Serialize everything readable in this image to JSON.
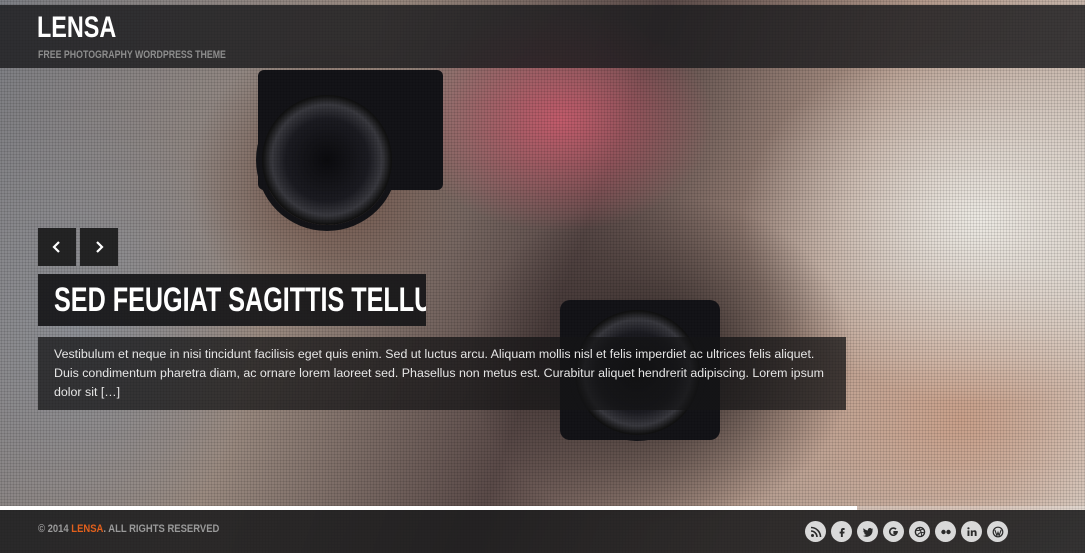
{
  "site": {
    "title": "LENSA",
    "tagline": "FREE PHOTOGRAPHY WORDPRESS THEME"
  },
  "slider": {
    "prev_icon": "chevron-left-icon",
    "next_icon": "chevron-right-icon",
    "slide_title": "SED FEUGIAT SAGITTIS TELLUS",
    "excerpt": "Vestibulum et neque in nisi tincidunt facilisis eget quis enim. Sed ut luctus arcu. Aliquam mollis nisl et felis imperdiet ac ultrices felis aliquet. Duis condimentum pharetra diam, ac ornare lorem laoreet sed. Phasellus non metus est. Curabitur aliquet hendrerit adipiscing. Lorem ipsum dolor sit […]",
    "progress_fraction": 0.79
  },
  "footer": {
    "copyright_prefix": "© 2014",
    "brand": "LENSA",
    "copyright_suffix": ". ALL RIGHTS RESERVED",
    "social": [
      {
        "name": "rss-icon",
        "glyph": "rss"
      },
      {
        "name": "facebook-icon",
        "glyph": "f"
      },
      {
        "name": "twitter-icon",
        "glyph": "t"
      },
      {
        "name": "google-plus-icon",
        "glyph": "g"
      },
      {
        "name": "dribbble-icon",
        "glyph": "d"
      },
      {
        "name": "flickr-icon",
        "glyph": "••"
      },
      {
        "name": "linkedin-icon",
        "glyph": "in"
      },
      {
        "name": "wordpress-icon",
        "glyph": "W"
      }
    ]
  },
  "colors": {
    "accent": "#e2601c",
    "panel": "#1c1c1e"
  }
}
